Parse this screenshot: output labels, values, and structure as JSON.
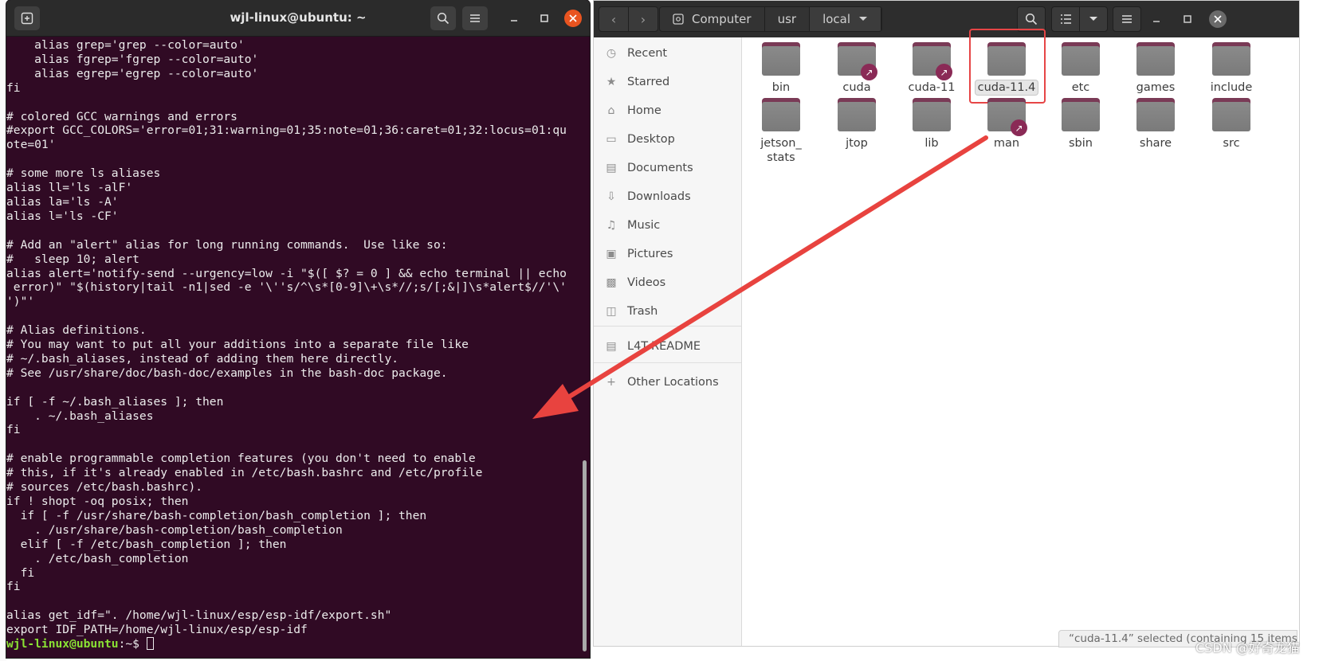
{
  "terminal": {
    "title": "wjl-linux@ubuntu: ~",
    "lines": [
      "    alias grep='grep --color=auto'",
      "    alias fgrep='fgrep --color=auto'",
      "    alias egrep='egrep --color=auto'",
      "fi",
      "",
      "# colored GCC warnings and errors",
      "#export GCC_COLORS='error=01;31:warning=01;35:note=01;36:caret=01;32:locus=01:qu",
      "ote=01'",
      "",
      "# some more ls aliases",
      "alias ll='ls -alF'",
      "alias la='ls -A'",
      "alias l='ls -CF'",
      "",
      "# Add an \"alert\" alias for long running commands.  Use like so:",
      "#   sleep 10; alert",
      "alias alert='notify-send --urgency=low -i \"$([ $? = 0 ] && echo terminal || echo",
      " error)\" \"$(history|tail -n1|sed -e '\\''s/^\\s*[0-9]\\+\\s*//;s/[;&|]\\s*alert$//'\\'",
      "')\"'",
      "",
      "# Alias definitions.",
      "# You may want to put all your additions into a separate file like",
      "# ~/.bash_aliases, instead of adding them here directly.",
      "# See /usr/share/doc/bash-doc/examples in the bash-doc package.",
      "",
      "if [ -f ~/.bash_aliases ]; then",
      "    . ~/.bash_aliases",
      "fi",
      "",
      "# enable programmable completion features (you don't need to enable",
      "# this, if it's already enabled in /etc/bash.bashrc and /etc/profile",
      "# sources /etc/bash.bashrc).",
      "if ! shopt -oq posix; then",
      "  if [ -f /usr/share/bash-completion/bash_completion ]; then",
      "    . /usr/share/bash-completion/bash_completion",
      "  elif [ -f /etc/bash_completion ]; then",
      "    . /etc/bash_completion",
      "  fi",
      "fi",
      "",
      "alias get_idf=\". /home/wjl-linux/esp/esp-idf/export.sh\"",
      "export IDF_PATH=/home/wjl-linux/esp/esp-idf"
    ],
    "prompt_user": "wjl-linux@ubuntu",
    "prompt_rest": ":~$ "
  },
  "files": {
    "breadcrumbs": [
      "Computer",
      "usr",
      "local"
    ],
    "sidebar": [
      {
        "label": "Recent",
        "icon": "clock-icon"
      },
      {
        "label": "Starred",
        "icon": "star-icon"
      },
      {
        "label": "Home",
        "icon": "home-icon"
      },
      {
        "label": "Desktop",
        "icon": "desktop-icon"
      },
      {
        "label": "Documents",
        "icon": "documents-icon"
      },
      {
        "label": "Downloads",
        "icon": "downloads-icon"
      },
      {
        "label": "Music",
        "icon": "music-icon"
      },
      {
        "label": "Pictures",
        "icon": "pictures-icon"
      },
      {
        "label": "Videos",
        "icon": "videos-icon"
      },
      {
        "label": "Trash",
        "icon": "trash-icon"
      },
      {
        "label": "L4T-README",
        "icon": "drive-icon"
      },
      {
        "label": "Other Locations",
        "icon": "plus-icon"
      }
    ],
    "items": [
      {
        "name": "bin",
        "link": false
      },
      {
        "name": "cuda",
        "link": true
      },
      {
        "name": "cuda-11",
        "link": true
      },
      {
        "name": "cuda-11.4",
        "link": false,
        "selected": true
      },
      {
        "name": "etc",
        "link": false
      },
      {
        "name": "games",
        "link": false
      },
      {
        "name": "include",
        "link": false
      },
      {
        "name": "jetson_\nstats",
        "link": false
      },
      {
        "name": "jtop",
        "link": false
      },
      {
        "name": "lib",
        "link": false
      },
      {
        "name": "man",
        "link": true
      },
      {
        "name": "sbin",
        "link": false
      },
      {
        "name": "share",
        "link": false
      },
      {
        "name": "src",
        "link": false
      }
    ],
    "status": "“cuda-11.4” selected  (containing 15 items)"
  },
  "watermark": "CSDN @好奇龙猫",
  "colors": {
    "terminal_bg": "#300a24",
    "prompt": "#8ae234",
    "highlight": "#e64546",
    "folder_tab": "#7a3a56"
  }
}
